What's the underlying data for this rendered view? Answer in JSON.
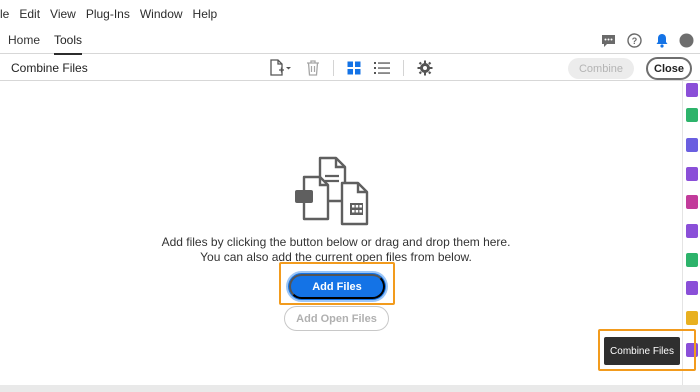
{
  "menu": [
    "le",
    "Edit",
    "View",
    "Plug-Ins",
    "Window",
    "Help"
  ],
  "tabs": [
    {
      "label": "Home",
      "active": false
    },
    {
      "label": "Tools",
      "active": true
    }
  ],
  "header_icons": [
    "comment-icon",
    "help-icon",
    "notification-bell-icon",
    "avatar"
  ],
  "toolbar": {
    "title": "Combine Files",
    "icons": [
      "add-files-dropdown-icon",
      "trash-icon",
      "grid-view-icon",
      "list-view-icon",
      "settings-gear-icon"
    ],
    "combine_label": "Combine",
    "close_label": "Close"
  },
  "main": {
    "instruction_line1": "Add files by clicking the button below or drag and drop them here.",
    "instruction_line2": "You can also add the current open files from below.",
    "add_files_label": "Add Files",
    "add_open_files_label": "Add Open Files"
  },
  "tooltip": {
    "label": "Combine Files"
  },
  "colors": {
    "accent_blue": "#1473e6",
    "highlight_orange": "#f29b1d",
    "tooltip_bg": "#2f2f2f"
  }
}
